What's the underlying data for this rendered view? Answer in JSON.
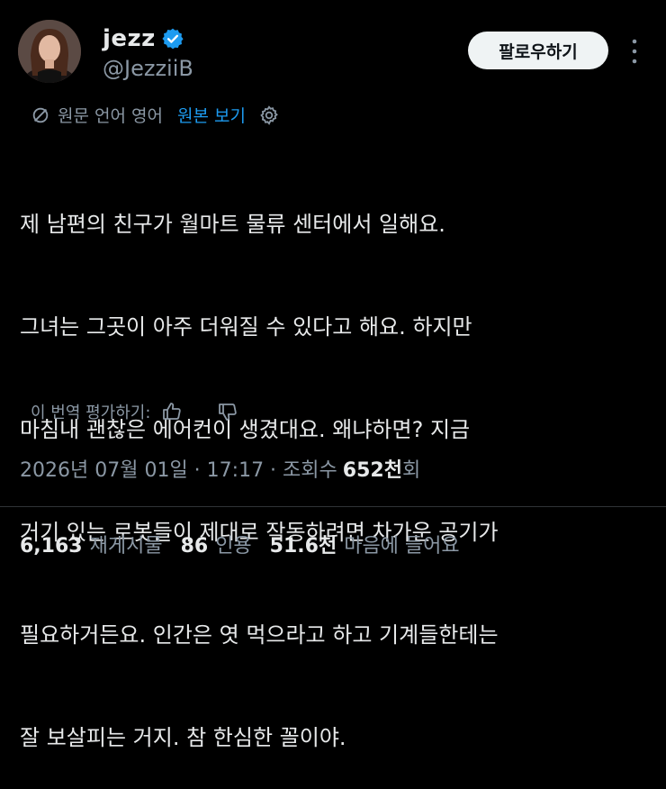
{
  "author": {
    "display_name": "jezz",
    "handle": "@JezziiB",
    "verified_color": "#1d9bf0"
  },
  "follow_label": "팔로우하기",
  "translation": {
    "info_text": "원문 언어 영어",
    "show_original_label": "원본 보기"
  },
  "tweet_lines": [
    "제 남편의 친구가 월마트 물류 센터에서 일해요.",
    "그녀는 그곳이 아주 더워질 수 있다고 해요. 하지만",
    "마침내 괜찮은 에어컨이 생겼대요. 왜냐하면? 지금",
    "거기 있는 로봇들이 제대로 작동하려면 차가운 공기가",
    "필요하거든요. 인간은 엿 먹으라고 하고 기계들한테는",
    "잘 보살피는 거지. 참 한심한 꼴이야."
  ],
  "rate_translation_label": "이 번역 평가하기:",
  "meta": {
    "timestamp": "2026년 07월 01일 · 17:17 · 조회수",
    "views": "652천",
    "views_suffix": "회"
  },
  "stats": {
    "reposts_count": "6,163",
    "reposts_label": "재게시물",
    "quotes_count": "86",
    "quotes_label": "인용",
    "likes_count": "51.6천",
    "likes_label": "마음에 들어요"
  }
}
